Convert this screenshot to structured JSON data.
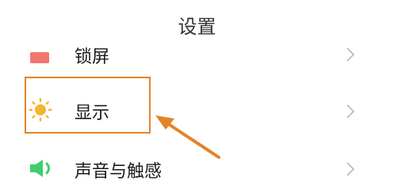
{
  "header": {
    "title": "设置"
  },
  "items": [
    {
      "label": "锁屏",
      "icon": "lock-screen-icon"
    },
    {
      "label": "显示",
      "icon": "sun-icon"
    },
    {
      "label": "声音与触感",
      "icon": "speaker-icon"
    }
  ],
  "colors": {
    "highlight": "#e38426",
    "lock_icon": "#f0776d",
    "sun_icon": "#f3b632",
    "sound_icon": "#3ecf6e",
    "chevron": "#b7b7b7"
  }
}
